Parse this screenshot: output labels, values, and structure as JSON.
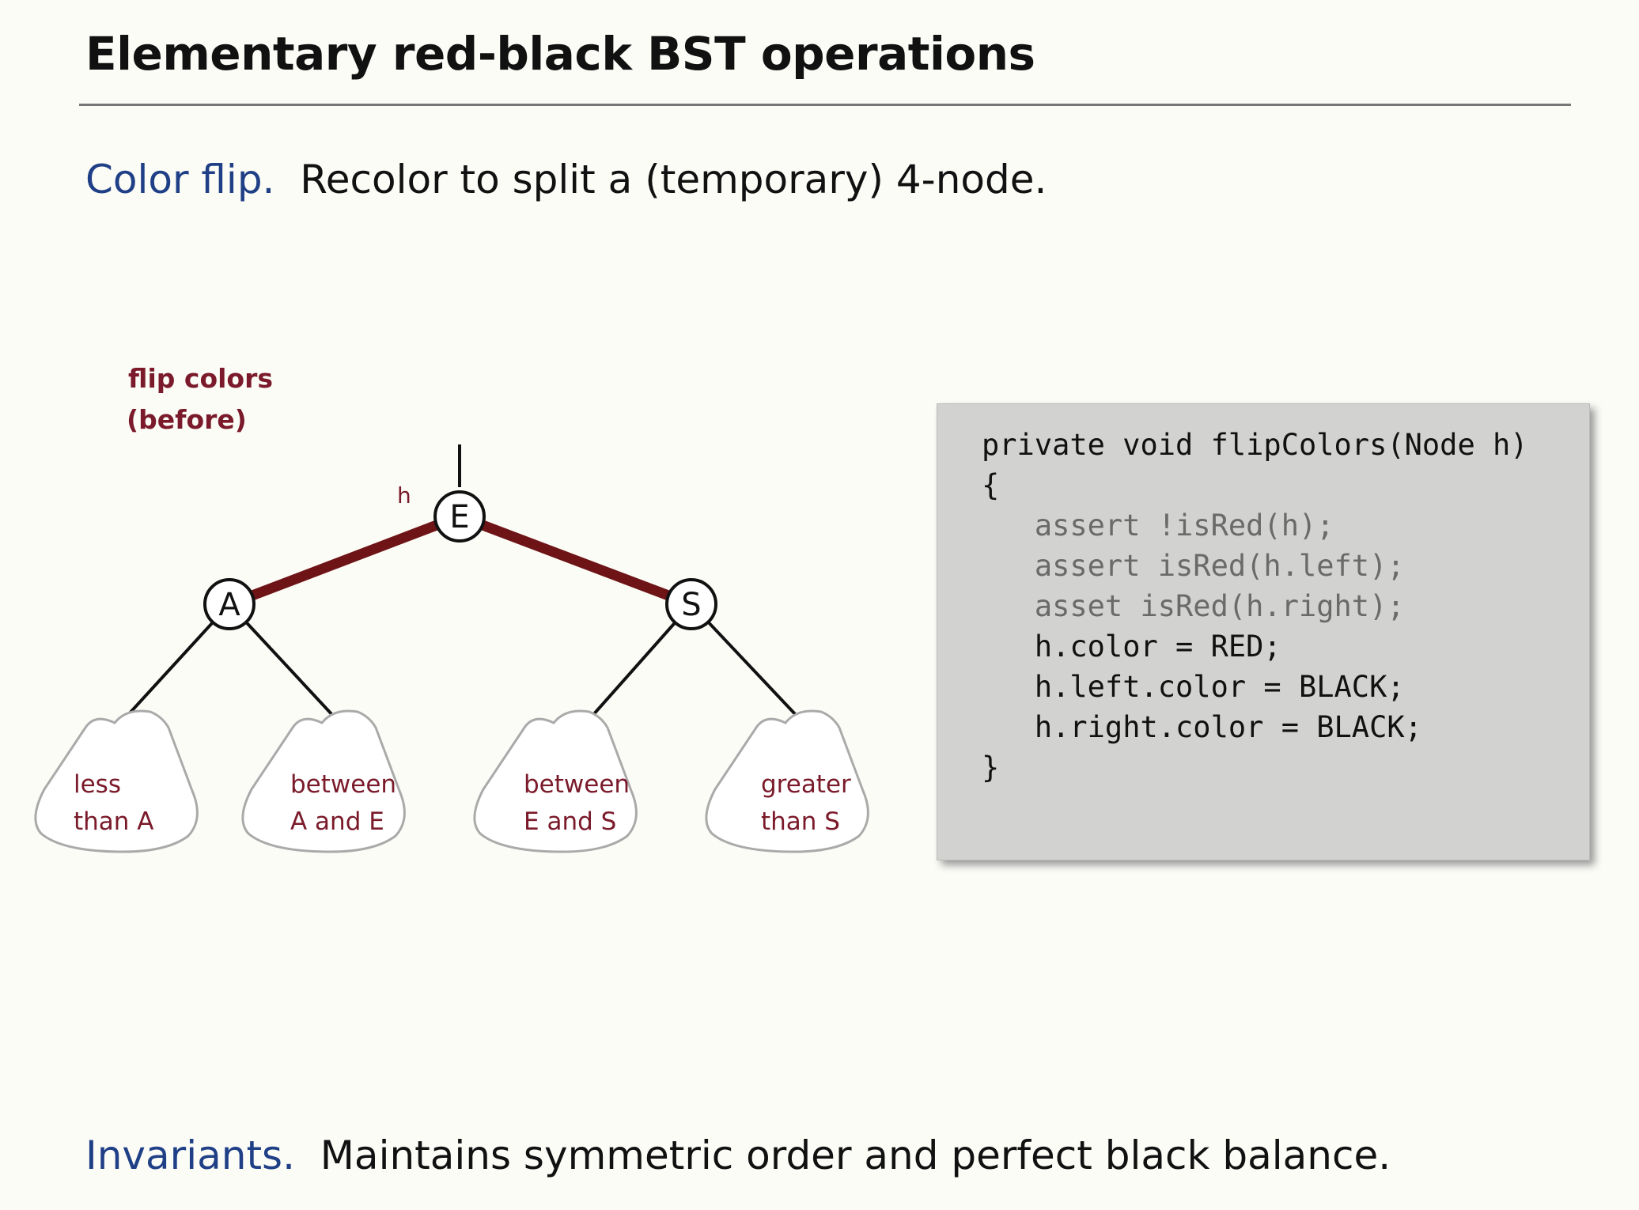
{
  "slide": {
    "title": "Elementary red-black BST operations",
    "intro": {
      "keyword": "Color flip.",
      "text": "Recolor to split a (temporary) 4-node."
    },
    "footer": {
      "keyword": "Invariants.",
      "text": "Maintains symmetric order and perfect black balance."
    }
  },
  "colors": {
    "keyword_blue": "#1f3f86",
    "red_link": "#6e1416",
    "label_maroon": "#7a1a2a",
    "code_bg": "#d2d2d0"
  },
  "diagram": {
    "caption_line1": "flip colors",
    "caption_line2": "(before)",
    "pointer_label": "h",
    "nodes": {
      "root": "E",
      "left": "A",
      "right": "S"
    },
    "subtrees": [
      {
        "line1": "less",
        "line2": "than A"
      },
      {
        "line1": "between",
        "line2": "A and E"
      },
      {
        "line1": "between",
        "line2": "E and S"
      },
      {
        "line1": "greater",
        "line2": "than S"
      }
    ]
  },
  "code": [
    {
      "text": "private void flipColors(Node h)",
      "style": "normal"
    },
    {
      "text": "{",
      "style": "normal"
    },
    {
      "text": "   assert !isRed(h);",
      "style": "dim"
    },
    {
      "text": "   assert isRed(h.left);",
      "style": "dim"
    },
    {
      "text": "   asset isRed(h.right);",
      "style": "dim"
    },
    {
      "text": "   h.color = RED;",
      "style": "normal"
    },
    {
      "text": "   h.left.color = BLACK;",
      "style": "normal"
    },
    {
      "text": "   h.right.color = BLACK;",
      "style": "normal"
    },
    {
      "text": "}",
      "style": "normal"
    }
  ]
}
